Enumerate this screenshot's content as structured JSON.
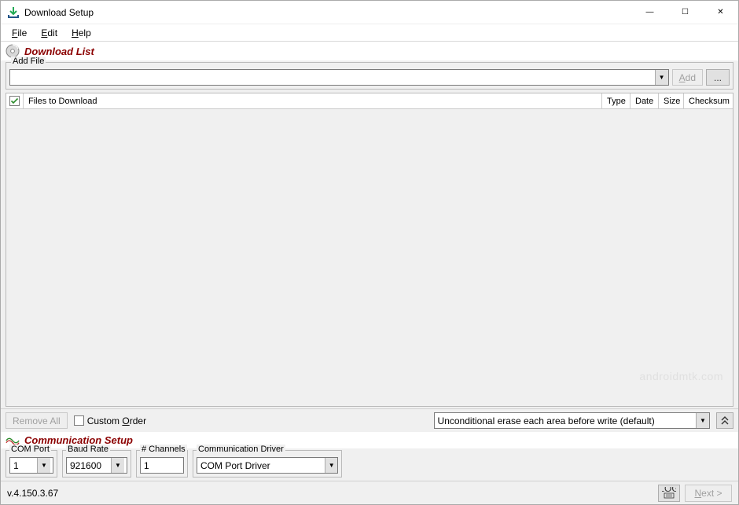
{
  "window": {
    "title": "Download Setup",
    "controls": {
      "min": "—",
      "max": "☐",
      "close": "✕"
    }
  },
  "menu": {
    "file": "File",
    "edit": "Edit",
    "help": "Help"
  },
  "download_list": {
    "title": "Download List",
    "add_file_legend": "Add File",
    "add_button": "Add",
    "browse_button": "...",
    "columns": {
      "files": "Files to Download",
      "type": "Type",
      "date": "Date",
      "size": "Size",
      "checksum": "Checksum"
    },
    "remove_all": "Remove All",
    "custom_order": "Custom Order",
    "erase_option": "Unconditional erase each area before write (default)"
  },
  "comm": {
    "title": "Communication Setup",
    "com_port_legend": "COM Port",
    "com_port_value": "1",
    "baud_legend": "Baud Rate",
    "baud_value": "921600",
    "channels_legend": "# Channels",
    "channels_value": "1",
    "driver_legend": "Communication Driver",
    "driver_value": "COM Port Driver"
  },
  "status": {
    "version": "v.4.150.3.67",
    "log_label": "LOG",
    "next": "Next >"
  },
  "watermark": "androidmtk.com"
}
